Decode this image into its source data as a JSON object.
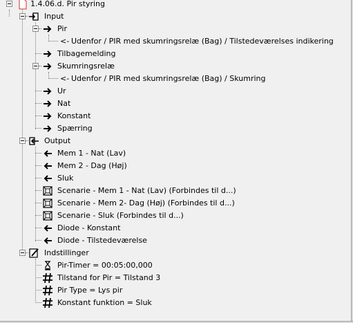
{
  "tree": {
    "root": {
      "label": "1.4.06.d. Pir styring",
      "icon": "document-icon"
    },
    "input": {
      "label": "Input",
      "children": [
        {
          "label": "Pir",
          "icon": "arrow-right-icon",
          "children": [
            {
              "label": "Udenfor / PIR med skumringsrelæ (Bag)  / Tilstedeværelses indikering",
              "icon": "link-arrow-icon",
              "prefix": "<-"
            }
          ]
        },
        {
          "label": "Tilbagemelding",
          "icon": "arrow-right-icon"
        },
        {
          "label": "Skumringsrelæ",
          "icon": "arrow-right-icon",
          "children": [
            {
              "label": "Udenfor / PIR med skumringsrelæ (Bag)  / Skumring",
              "icon": "link-arrow-icon",
              "prefix": "<-"
            }
          ]
        },
        {
          "label": "Ur",
          "icon": "arrow-right-icon"
        },
        {
          "label": "Nat",
          "icon": "arrow-right-icon"
        },
        {
          "label": "Konstant",
          "icon": "arrow-right-icon"
        },
        {
          "label": "Spærring",
          "icon": "arrow-right-icon"
        }
      ]
    },
    "output": {
      "label": "Output",
      "children": [
        {
          "label": "Mem 1 - Nat (Lav)",
          "icon": "arrow-left-icon"
        },
        {
          "label": "Mem 2 - Dag (Høj)",
          "icon": "arrow-left-icon"
        },
        {
          "label": "Sluk",
          "icon": "arrow-left-icon"
        },
        {
          "label": "Scenarie - Mem 1 - Nat (Lav) (Forbindes til d...)",
          "icon": "scene-icon"
        },
        {
          "label": "Scenarie - Mem 2- Dag (Høj) (Forbindes til d...)",
          "icon": "scene-icon"
        },
        {
          "label": "Scenarie - Sluk (Forbindes til d...)",
          "icon": "scene-icon"
        },
        {
          "label": "Diode - Konstant",
          "icon": "arrow-left-icon"
        },
        {
          "label": "Diode - Tilstedeværelse",
          "icon": "arrow-left-icon"
        }
      ]
    },
    "settings": {
      "label": "Indstillinger",
      "children": [
        {
          "label": "Pir-Timer = 00:05:00,000",
          "icon": "hourglass-icon"
        },
        {
          "label": "Tilstand for Pir = Tilstand 3",
          "icon": "hash-icon"
        },
        {
          "label": "Pir Type = Lys pir",
          "icon": "hash-icon"
        },
        {
          "label": "Konstant funktion = Sluk",
          "icon": "hash-icon"
        }
      ]
    }
  }
}
